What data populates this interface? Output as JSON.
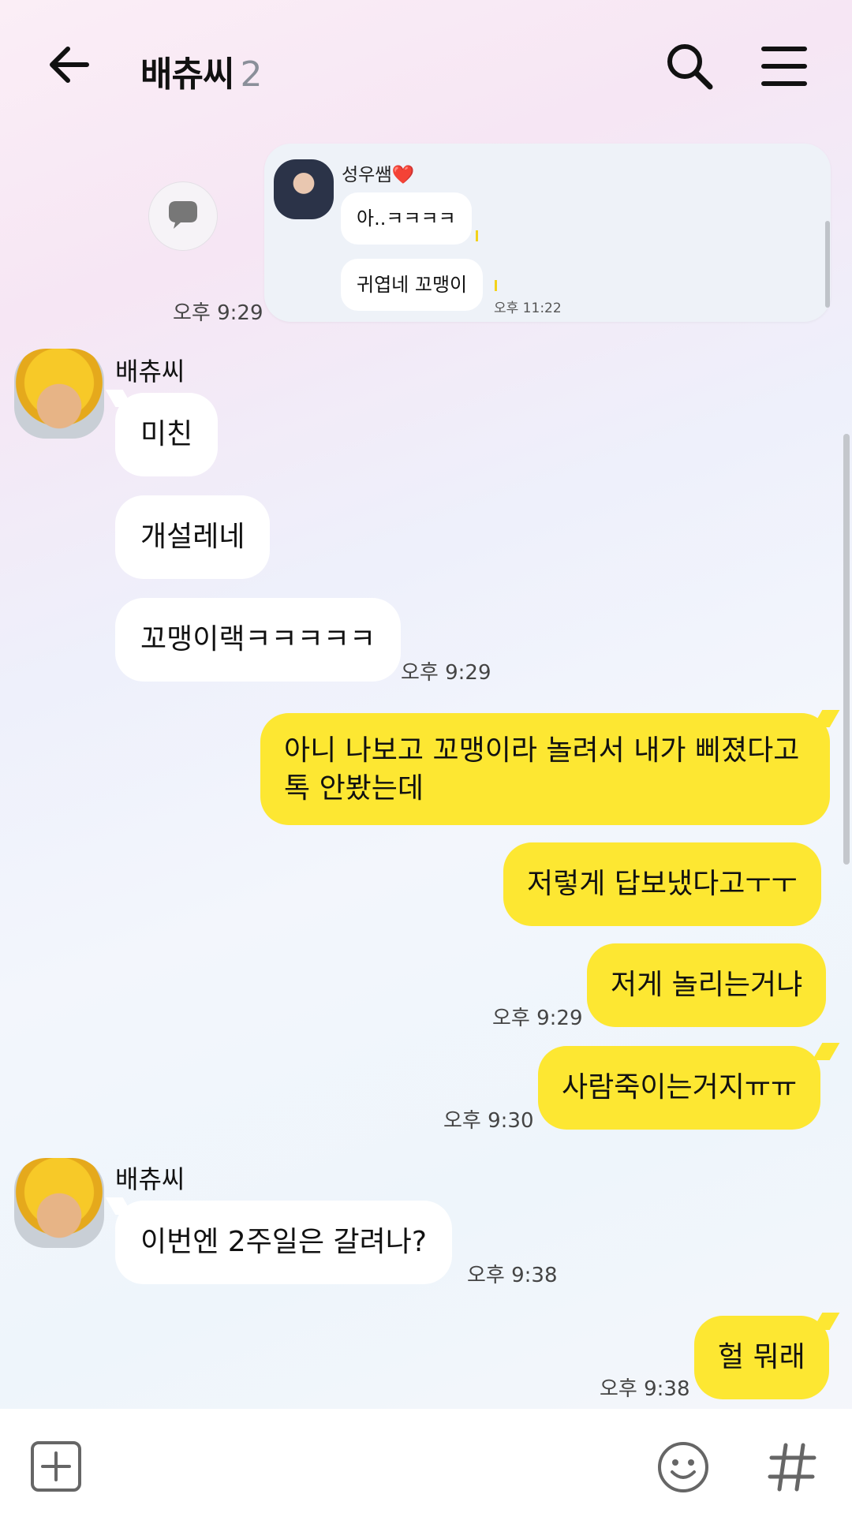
{
  "header": {
    "title": "배츄씨",
    "count": "2"
  },
  "forwarded": {
    "sender": "성우쌤❤️",
    "messages": [
      "아..ㅋㅋㅋㅋ",
      "귀엽네 꼬맹이"
    ],
    "time": "오후 11:22",
    "shared_time": "오후 9:29"
  },
  "chat": {
    "group1": {
      "sender": "배츄씨",
      "messages": [
        "미친",
        "개설레네",
        "꼬맹이랙ㅋㅋㅋㅋㅋ"
      ],
      "time": "오후 9:29"
    },
    "out1": {
      "line1": "아니 나보고 꼬맹이라 놀려서 내가 삐졌다고",
      "line2": "톡 안봤는데"
    },
    "out2": "저렇게 답보냈다고ㅜㅜ",
    "out3": "저게 놀리는거냐",
    "out3_time": "오후 9:29",
    "out4": "사람죽이는거지ㅠㅠ",
    "out4_time": "오후 9:30",
    "group2": {
      "sender": "배츄씨",
      "message": "이번엔 2주일은 갈려나?",
      "time": "오후 9:38"
    },
    "out5": "헐 뭐래",
    "out5_time": "오후 9:38"
  },
  "icons": {
    "back": "arrow-left-icon",
    "search": "search-icon",
    "menu": "hamburger-menu-icon",
    "share": "speech-bubble-icon",
    "attach": "plus-square-icon",
    "emoji": "smiley-icon",
    "hashtag": "hashtag-icon"
  },
  "colors": {
    "my_bubble": "#fde732",
    "their_bubble": "#ffffff"
  }
}
